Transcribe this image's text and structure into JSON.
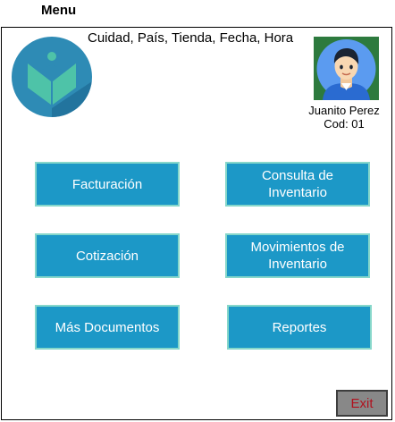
{
  "header": {
    "title": "Menu",
    "context_line": "Cuidad, País, Tienda, Fecha, Hora"
  },
  "logo": {
    "icon": "book-logo-icon",
    "colors": {
      "circle": "#2e8bb5",
      "book": "#4ec3a8"
    }
  },
  "user": {
    "avatar_icon": "user-avatar-icon",
    "name": "Juanito Perez",
    "code": "Cod: 01"
  },
  "menu": {
    "facturacion": "Facturación",
    "consulta_inventario": "Consulta de Inventario",
    "cotizacion": "Cotización",
    "movimientos_inventario": "Movimientos de Inventario",
    "mas_documentos": "Más Documentos",
    "reportes": "Reportes"
  },
  "footer": {
    "exit_label": "Exit"
  },
  "colors": {
    "button_fill": "#1c98c7",
    "button_border": "#86d7ca",
    "exit_fill": "#888888",
    "exit_text": "#b0121f"
  }
}
